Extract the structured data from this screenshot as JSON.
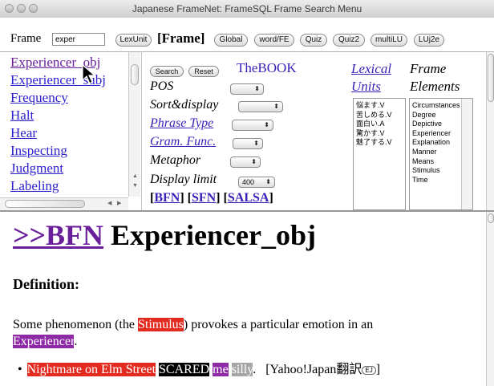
{
  "window": {
    "title": "Japanese FrameNet: FrameSQL Frame Search Menu"
  },
  "toolbar": {
    "frame_label": "Frame",
    "frame_input_value": "exper",
    "lexunit": "LexUnit",
    "frame_bracket": "[Frame]",
    "global": "Global",
    "wordfe": "word/FE",
    "quiz": "Quiz",
    "quiz2": "Quiz2",
    "multilu": "multiLU",
    "luj2e": "LUj2e"
  },
  "frames": [
    "Experiencer_obj",
    "Experiencer_subj",
    "Frequency",
    "Halt",
    "Hear",
    "Inspecting",
    "Judgment",
    "Labeling"
  ],
  "controls": {
    "search": "Search",
    "reset": "Reset",
    "thebook": "TheBOOK",
    "pos": "POS",
    "sort_display": "Sort&display",
    "phrase_type": "Phrase Type",
    "gram_func": "Gram. Func.",
    "metaphor": "Metaphor",
    "display_limit": "Display limit",
    "display_limit_value": "400",
    "bfn": "BFN",
    "sfn": "SFN",
    "salsa": "SALSA",
    "lexical": "Lexical",
    "units": "Units",
    "frame_word": "Frame",
    "elements_word": "Elements"
  },
  "lexical_units": [
    "悩ます.V",
    "苦しめる.V",
    "面白い.A",
    "驚かす.V",
    "魅了する.V"
  ],
  "frame_elements": [
    "Circumstances",
    "Degree",
    "Depictive",
    "Experiencer",
    "Explanation",
    "Manner",
    "Means",
    "Stimulus",
    "Time"
  ],
  "detail": {
    "bfn_link": ">>BFN",
    "frame_name": "Experiencer_obj",
    "definition_label": "Definition:",
    "def_part1": "Some phenomenon (the ",
    "def_stimulus": "Stimulus",
    "def_part2": ") provokes a particular emotion in an",
    "def_experiencer": "Experiencer",
    "def_end": ".",
    "ex_stimulus": "Nightmare on Elm Street",
    "ex_target": "SCARED",
    "ex_experiencer": "me",
    "ex_degree": "silly",
    "ex_after": ".",
    "yahoo": "[Yahoo!Japan翻訳",
    "yahoo_icon": "EJ",
    "yahoo_close": "]"
  },
  "colors": {
    "link": "#2b1fd0",
    "visited": "#6a1f9a",
    "stimulus": "#e32a1f",
    "experiencer": "#8e2aa6",
    "target": "#000000",
    "degree": "#a6a6a6"
  }
}
